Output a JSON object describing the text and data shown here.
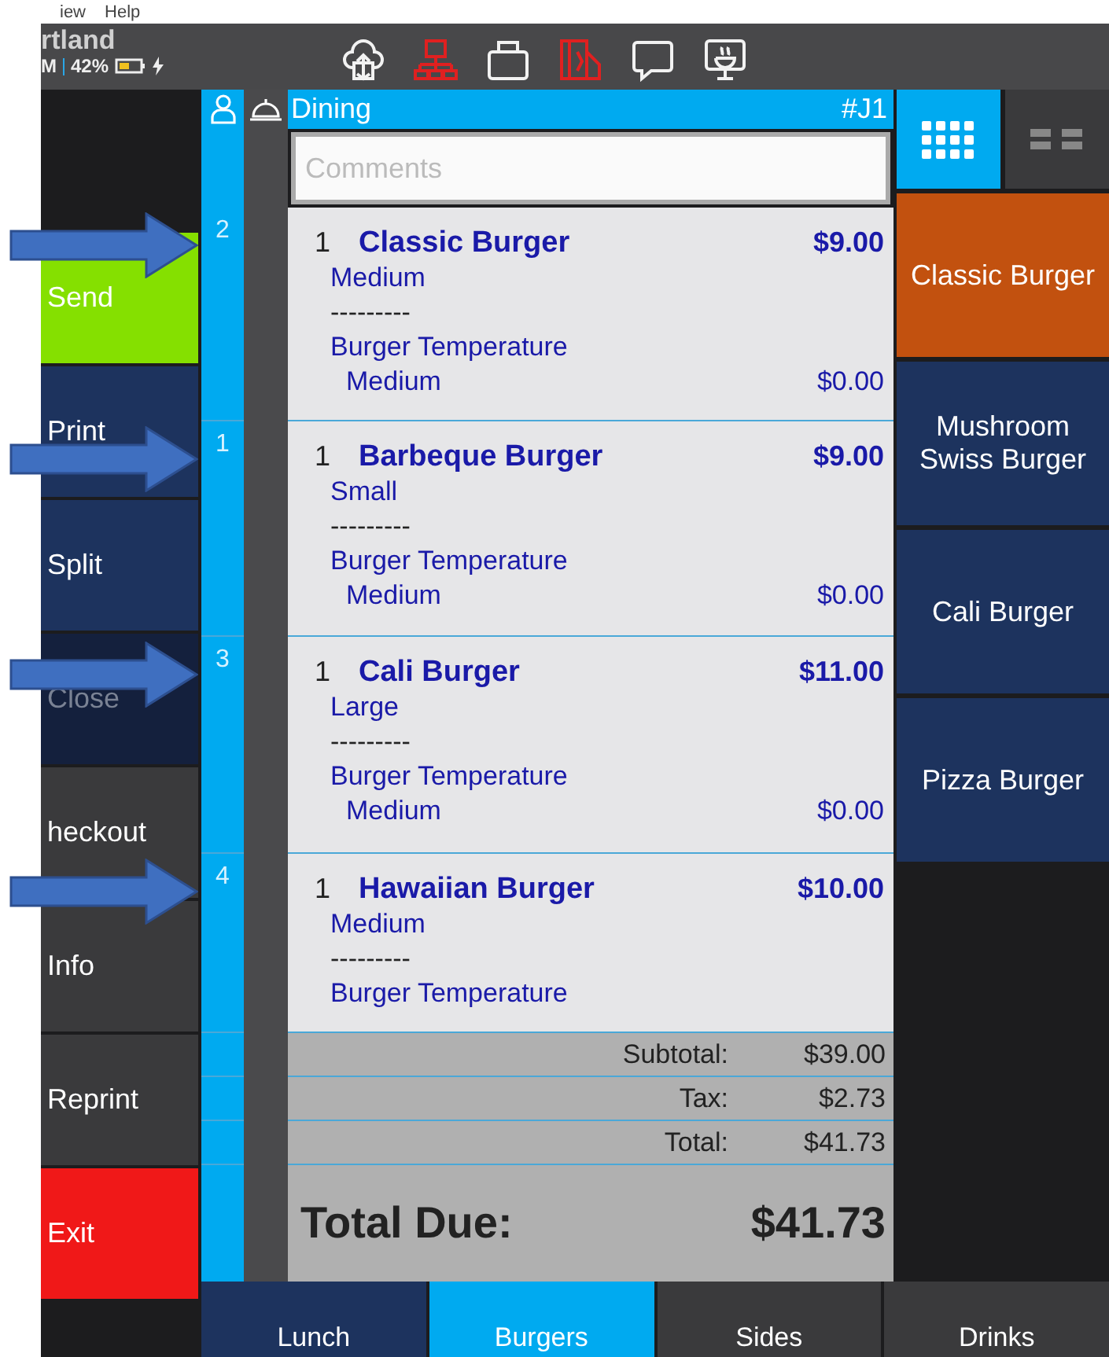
{
  "menu_bar": [
    "iew",
    "Help"
  ],
  "header": {
    "location": "rtland",
    "clock": "M",
    "battery": "42%",
    "charging": true,
    "icons": [
      {
        "kind": "cloud",
        "alert": false
      },
      {
        "kind": "network",
        "alert": true
      },
      {
        "kind": "printer",
        "alert": false
      },
      {
        "kind": "card",
        "alert": true
      },
      {
        "kind": "chat",
        "alert": false
      },
      {
        "kind": "kitchen",
        "alert": false
      }
    ]
  },
  "sidebar": [
    {
      "label": "Send",
      "kind": "primary",
      "disabled": false
    },
    {
      "label": "Print",
      "kind": "action",
      "disabled": false
    },
    {
      "label": "Split",
      "kind": "action",
      "disabled": false
    },
    {
      "label": "Close",
      "kind": "action",
      "disabled": true
    },
    {
      "label": "heckout",
      "kind": "muted",
      "disabled": false
    },
    {
      "label": "Info",
      "kind": "muted",
      "disabled": false
    },
    {
      "label": "Reprint",
      "kind": "muted",
      "disabled": false
    },
    {
      "label": "Exit",
      "kind": "danger",
      "disabled": false
    }
  ],
  "order": {
    "type": "Dining",
    "ticket": "#J1",
    "comments_placeholder": "Comments",
    "items": [
      {
        "seat": "2",
        "qty": "1",
        "name": "Classic Burger",
        "price": "$9.00",
        "annotated": true,
        "lines": [
          {
            "kind": "size",
            "text": "Medium"
          },
          {
            "kind": "divider",
            "text": "---------"
          },
          {
            "kind": "group",
            "text": "Burger Temperature"
          },
          {
            "kind": "option",
            "text": "Medium",
            "price": "$0.00"
          }
        ]
      },
      {
        "seat": "1",
        "qty": "1",
        "name": "Barbeque Burger",
        "price": "$9.00",
        "annotated": true,
        "lines": [
          {
            "kind": "size",
            "text": "Small"
          },
          {
            "kind": "divider",
            "text": "---------"
          },
          {
            "kind": "group",
            "text": "Burger Temperature"
          },
          {
            "kind": "option",
            "text": "Medium",
            "price": "$0.00"
          }
        ]
      },
      {
        "seat": "3",
        "qty": "1",
        "name": "Cali Burger",
        "price": "$11.00",
        "annotated": true,
        "lines": [
          {
            "kind": "size",
            "text": "Large"
          },
          {
            "kind": "divider",
            "text": "---------"
          },
          {
            "kind": "group",
            "text": "Burger Temperature"
          },
          {
            "kind": "option",
            "text": "Medium",
            "price": "$0.00"
          }
        ]
      },
      {
        "seat": "4",
        "qty": "1",
        "name": "Hawaiian Burger",
        "price": "$10.00",
        "annotated": true,
        "lines": [
          {
            "kind": "size",
            "text": "Medium"
          },
          {
            "kind": "divider",
            "text": "---------"
          },
          {
            "kind": "group",
            "text": "Burger Temperature"
          }
        ]
      }
    ],
    "totals": [
      {
        "label": "Subtotal:",
        "value": "$39.00"
      },
      {
        "label": "Tax:",
        "value": "$2.73"
      },
      {
        "label": "Total:",
        "value": "$41.73"
      }
    ],
    "total_due": {
      "label": "Total Due:",
      "value": "$41.73"
    }
  },
  "view_modes": [
    {
      "kind": "grid",
      "selected": true
    },
    {
      "kind": "list",
      "selected": false
    }
  ],
  "menu_items": [
    {
      "label": "Classic Burger",
      "color": "#c2510f"
    },
    {
      "label": "Mushroom Swiss Burger",
      "color": "#1d335e"
    },
    {
      "label": "Cali Burger",
      "color": "#1d335e"
    },
    {
      "label": "Pizza Burger",
      "color": "#1d335e"
    }
  ],
  "categories": [
    {
      "label": "Lunch",
      "selected": false,
      "color": "#1d335e"
    },
    {
      "label": "Burgers",
      "selected": true
    },
    {
      "label": "Sides",
      "selected": false,
      "color": "#3a3a3c"
    },
    {
      "label": "Drinks",
      "selected": false,
      "color": "#3a3a3c"
    }
  ]
}
